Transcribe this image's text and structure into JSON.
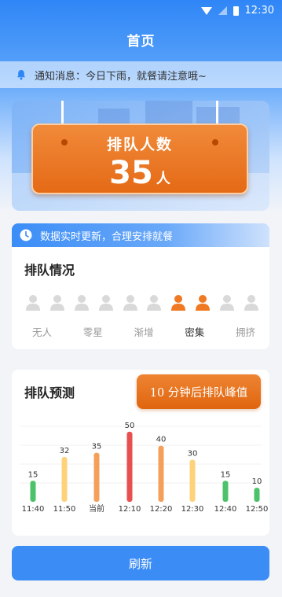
{
  "status_bar": {
    "time": "12:30"
  },
  "app": {
    "title": "首页"
  },
  "notice": {
    "text": "通知消息：今日下雨，就餐请注意哦~"
  },
  "queue_sign": {
    "label": "排队人数",
    "count": "35",
    "unit": "人"
  },
  "realtime_banner": {
    "text": "数据实时更新，合理安排就餐"
  },
  "queue_status": {
    "title": "排队情况",
    "levels": [
      "无人",
      "零星",
      "渐增",
      "密集",
      "拥挤"
    ],
    "active_level": "密集",
    "person_icons_total": 10,
    "person_icons_active": [
      6,
      7
    ]
  },
  "forecast": {
    "title": "排队预测",
    "peak_text": "10 分钟后排队峰值"
  },
  "chart_data": {
    "type": "bar",
    "categories": [
      "11:40",
      "11:50",
      "当前",
      "12:10",
      "12:20",
      "12:30",
      "12:40",
      "12:50"
    ],
    "values": [
      15,
      32,
      35,
      50,
      40,
      30,
      15,
      10
    ],
    "bar_colors": [
      "#4cc36a",
      "#fdd27a",
      "#f5a05a",
      "#e8504f",
      "#f5a05a",
      "#fdd27a",
      "#4cc36a",
      "#4cc36a"
    ],
    "ylim": [
      0,
      55
    ]
  },
  "actions": {
    "refresh_label": "刷新"
  },
  "colors": {
    "primary": "#3b8cf5",
    "accent": "#e56a16",
    "active_person": "#f07a24",
    "inactive_person": "#d9d9d9"
  }
}
